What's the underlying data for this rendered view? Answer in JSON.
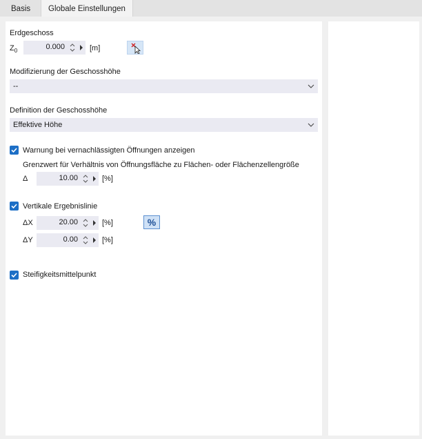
{
  "tabs": [
    {
      "label": "Basis",
      "active": false
    },
    {
      "label": "Globale Einstellungen",
      "active": true
    }
  ],
  "erdgeschoss": {
    "heading": "Erdgeschoss",
    "z0_label": "Z",
    "z0_sub": "0",
    "z0_value": "0.000",
    "z0_unit": "[m]",
    "pick_icon": "pick-cursor-icon"
  },
  "modifizierung": {
    "heading": "Modifizierung der Geschosshöhe",
    "selected": "--"
  },
  "definition": {
    "heading": "Definition der Geschosshöhe",
    "selected": "Effektive Höhe"
  },
  "warnung": {
    "checkbox_label": "Warnung bei vernachlässigten Öffnungen anzeigen",
    "checked": true,
    "grenzwert_text": "Grenzwert für Verhältnis von Öffnungsfläche zu Flächen- oder Flächenzellengröße",
    "delta_label": "Δ",
    "delta_value": "10.00",
    "delta_unit": "[%]"
  },
  "vertikale": {
    "checkbox_label": "Vertikale Ergebnislinie",
    "checked": true,
    "dx_label": "ΔX",
    "dx_value": "20.00",
    "dx_unit": "[%]",
    "dy_label": "ΔY",
    "dy_value": "0.00",
    "dy_unit": "[%]",
    "percent_button": "%"
  },
  "steifigkeit": {
    "checkbox_label": "Steifigkeitsmittelpunkt",
    "checked": true
  },
  "colors": {
    "accent": "#1d6fc6",
    "field_bg": "#eaeaf2",
    "panel_bg": "#ffffff",
    "window_bg": "#f0f0f0"
  }
}
